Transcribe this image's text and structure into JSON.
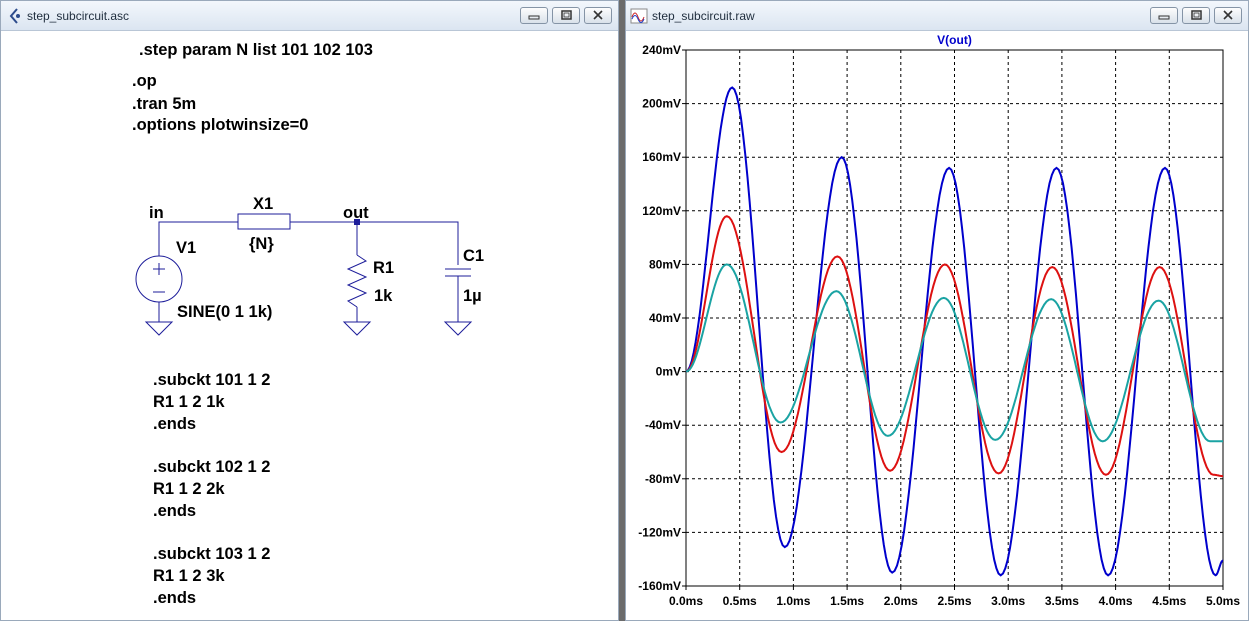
{
  "schematic_window": {
    "title": "step_subcircuit.asc",
    "directives": [
      ".step param N list 101 102 103",
      ".op",
      ".tran 5m",
      ".options plotwinsize=0"
    ],
    "components": {
      "net_in": "in",
      "net_out": "out",
      "x1_name": "X1",
      "x1_value": "{N}",
      "v1_name": "V1",
      "v1_value": "SINE(0 1 1k)",
      "r1_name": "R1",
      "r1_value": "1k",
      "c1_name": "C1",
      "c1_value": "1µ"
    },
    "subcircuits": [
      [
        ".subckt 101 1 2",
        "R1 1 2 1k",
        ".ends"
      ],
      [
        ".subckt 102 1 2",
        "R1 1 2 2k",
        ".ends"
      ],
      [
        ".subckt 103 1 2",
        "R1 1 2 3k",
        ".ends"
      ]
    ]
  },
  "waveform_window": {
    "title": "step_subcircuit.raw"
  },
  "chart_data": {
    "type": "line",
    "title": "V(out)",
    "xlabel": "",
    "ylabel": "",
    "xlim": [
      0,
      5.0
    ],
    "ylim": [
      -160,
      240
    ],
    "x_ticks": [
      0,
      0.5,
      1.0,
      1.5,
      2.0,
      2.5,
      3.0,
      3.5,
      4.0,
      4.5,
      5.0
    ],
    "x_tick_labels": [
      "0.0ms",
      "0.5ms",
      "1.0ms",
      "1.5ms",
      "2.0ms",
      "2.5ms",
      "3.0ms",
      "3.5ms",
      "4.0ms",
      "4.5ms",
      "5.0ms"
    ],
    "y_ticks": [
      -160,
      -120,
      -80,
      -40,
      0,
      40,
      80,
      120,
      160,
      200,
      240
    ],
    "y_tick_labels": [
      "-160mV",
      "-120mV",
      "-80mV",
      "-40mV",
      "0mV",
      "40mV",
      "80mV",
      "120mV",
      "160mV",
      "200mV",
      "240mV"
    ],
    "grid": true,
    "series": [
      {
        "color": "#0000cc",
        "x": [
          0,
          0.43,
          0.92,
          1.45,
          1.92,
          2.45,
          2.93,
          3.45,
          3.93,
          4.46,
          4.93,
          5.0
        ],
        "values": [
          0,
          212,
          -131,
          160,
          -150,
          152,
          -152,
          152,
          -152,
          152,
          -152,
          -141
        ]
      },
      {
        "color": "#dd1111",
        "x": [
          0,
          0.38,
          0.89,
          1.41,
          1.9,
          2.41,
          2.91,
          3.41,
          3.91,
          4.41,
          4.91,
          5.0
        ],
        "values": [
          0,
          116,
          -60,
          86,
          -74,
          80,
          -76,
          78,
          -77,
          78,
          -77,
          -78
        ]
      },
      {
        "color": "#1aa3a3",
        "x": [
          0,
          0.38,
          0.88,
          1.4,
          1.88,
          2.4,
          2.88,
          3.4,
          3.88,
          4.4,
          4.88,
          5.0
        ],
        "values": [
          0,
          80,
          -38,
          60,
          -48,
          55,
          -51,
          54,
          -52,
          53,
          -52,
          -52
        ]
      }
    ]
  }
}
